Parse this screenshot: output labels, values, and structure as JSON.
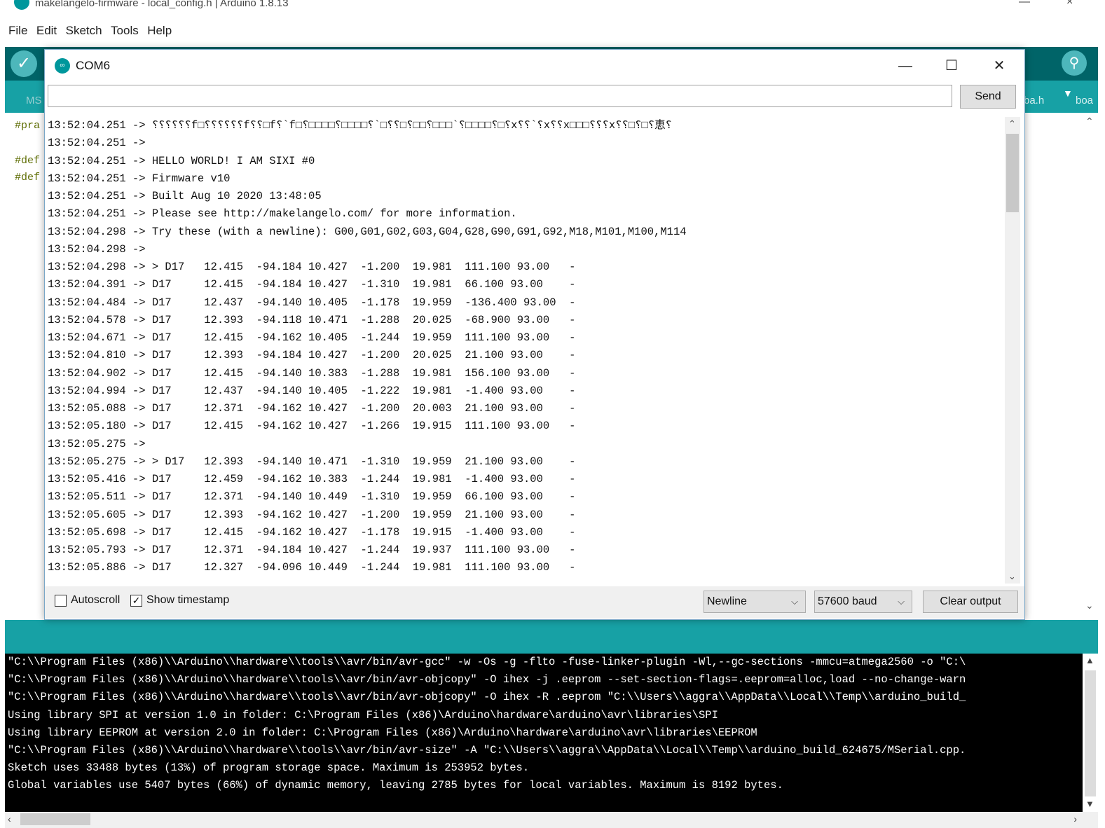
{
  "window": {
    "title": "makelangelo-firmware - local_config.h | Arduino 1.8.13",
    "minimize": "—",
    "close": "×"
  },
  "menu": [
    "File",
    "Edit",
    "Sketch",
    "Tools",
    "Help"
  ],
  "toolbar": {
    "verify_glyph": "✓",
    "monitor_glyph": "⚲"
  },
  "tabs": {
    "left": "MS",
    "right1": "ba.h",
    "right2": "boa",
    "dropdown_glyph": "▼"
  },
  "editor": {
    "lines": [
      "#pra",
      "#def",
      "#def"
    ]
  },
  "serial_monitor": {
    "title": "COM6",
    "input_value": "",
    "send_label": "Send",
    "output": [
      "13:52:04.251 -> ⸮⸮⸮⸮⸮⸮f□⸮⸮⸮⸮⸮⸮f⸮⸮□f⸮`f□⸮□□□□⸮□□□□⸮`□⸮⸮□⸮□□⸮□□□`⸮□□□□⸮□⸮x⸮⸮`⸮x⸮⸮x□□□⸮⸮⸮x⸮⸮□⸮□⸮恵⸮",
      "13:52:04.251 ->",
      "13:52:04.251 -> HELLO WORLD! I AM SIXI #0",
      "13:52:04.251 -> Firmware v10",
      "13:52:04.251 -> Built Aug 10 2020 13:48:05",
      "13:52:04.251 -> Please see http://makelangelo.com/ for more information.",
      "13:52:04.298 -> Try these (with a newline): G00,G01,G02,G03,G04,G28,G90,G91,G92,M18,M101,M100,M114",
      "13:52:04.298 ->",
      "13:52:04.298 -> > D17   12.415  -94.184 10.427  -1.200  19.981  111.100 93.00   -",
      "13:52:04.391 -> D17     12.415  -94.184 10.427  -1.310  19.981  66.100 93.00    -",
      "13:52:04.484 -> D17     12.437  -94.140 10.405  -1.178  19.959  -136.400 93.00  -",
      "13:52:04.578 -> D17     12.393  -94.118 10.471  -1.288  20.025  -68.900 93.00   -",
      "13:52:04.671 -> D17     12.415  -94.162 10.405  -1.244  19.959  111.100 93.00   -",
      "13:52:04.810 -> D17     12.393  -94.184 10.427  -1.200  20.025  21.100 93.00    -",
      "13:52:04.902 -> D17     12.415  -94.140 10.383  -1.288  19.981  156.100 93.00   -",
      "13:52:04.994 -> D17     12.437  -94.140 10.405  -1.222  19.981  -1.400 93.00    -",
      "13:52:05.088 -> D17     12.371  -94.162 10.427  -1.200  20.003  21.100 93.00    -",
      "13:52:05.180 -> D17     12.415  -94.162 10.427  -1.266  19.915  111.100 93.00   -",
      "13:52:05.275 ->",
      "13:52:05.275 -> > D17   12.393  -94.140 10.471  -1.310  19.959  21.100 93.00    -",
      "13:52:05.416 -> D17     12.459  -94.162 10.383  -1.244  19.981  -1.400 93.00    -",
      "13:52:05.511 -> D17     12.371  -94.140 10.449  -1.310  19.959  66.100 93.00    -",
      "13:52:05.605 -> D17     12.393  -94.162 10.427  -1.200  19.959  21.100 93.00    -",
      "13:52:05.698 -> D17     12.415  -94.162 10.427  -1.178  19.915  -1.400 93.00    -",
      "13:52:05.793 -> D17     12.371  -94.184 10.427  -1.244  19.937  111.100 93.00   -",
      "13:52:05.886 -> D17     12.327  -94.096 10.449  -1.244  19.981  111.100 93.00   -"
    ],
    "autoscroll_label": "Autoscroll",
    "autoscroll_checked": false,
    "timestamp_label": "Show timestamp",
    "timestamp_checked": true,
    "line_ending": "Newline",
    "baud": "57600 baud",
    "clear_label": "Clear output"
  },
  "console": {
    "lines": [
      "\"C:\\\\Program Files (x86)\\\\Arduino\\\\hardware\\\\tools\\\\avr/bin/avr-gcc\" -w -Os -g -flto -fuse-linker-plugin -Wl,--gc-sections -mmcu=atmega2560 -o \"C:\\",
      "\"C:\\\\Program Files (x86)\\\\Arduino\\\\hardware\\\\tools\\\\avr/bin/avr-objcopy\" -O ihex -j .eeprom --set-section-flags=.eeprom=alloc,load --no-change-warn",
      "\"C:\\\\Program Files (x86)\\\\Arduino\\\\hardware\\\\tools\\\\avr/bin/avr-objcopy\" -O ihex -R .eeprom \"C:\\\\Users\\\\aggra\\\\AppData\\\\Local\\\\Temp\\\\arduino_build_",
      "Using library SPI at version 1.0 in folder: C:\\Program Files (x86)\\Arduino\\hardware\\arduino\\avr\\libraries\\SPI",
      "Using library EEPROM at version 2.0 in folder: C:\\Program Files (x86)\\Arduino\\hardware\\arduino\\avr\\libraries\\EEPROM",
      "\"C:\\\\Program Files (x86)\\\\Arduino\\\\hardware\\\\tools\\\\avr/bin/avr-size\" -A \"C:\\\\Users\\\\aggra\\\\AppData\\\\Local\\\\Temp\\\\arduino_build_624675/MSerial.cpp.",
      "Sketch uses 33488 bytes (13%) of program storage space. Maximum is 253952 bytes.",
      "Global variables use 5407 bytes (66%) of dynamic memory, leaving 2785 bytes for local variables. Maximum is 8192 bytes."
    ]
  }
}
